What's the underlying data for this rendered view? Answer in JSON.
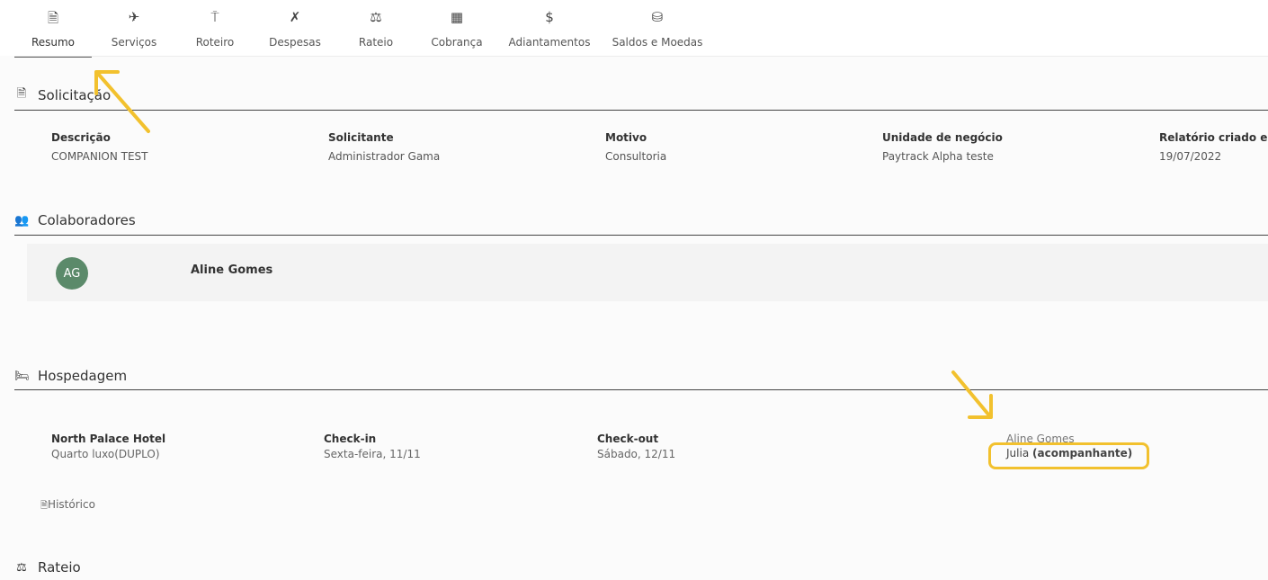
{
  "tabs": [
    {
      "label": "Resumo",
      "icon": "document-icon",
      "glyph": "🗎"
    },
    {
      "label": "Serviços",
      "icon": "airplane-icon",
      "glyph": "✈"
    },
    {
      "label": "Roteiro",
      "icon": "signpost-icon",
      "glyph": "⍑"
    },
    {
      "label": "Despesas",
      "icon": "utensils-icon",
      "glyph": "✗"
    },
    {
      "label": "Rateio",
      "icon": "scale-icon",
      "glyph": "⚖"
    },
    {
      "label": "Cobrança",
      "icon": "calculator-icon",
      "glyph": "▦"
    },
    {
      "label": "Adiantamentos",
      "icon": "dollar-icon",
      "glyph": "$"
    },
    {
      "label": "Saldos e Moedas",
      "icon": "coins-icon",
      "glyph": "⛁"
    }
  ],
  "active_tab": "Resumo",
  "solicitacao": {
    "title": "Solicitação",
    "icon_glyph": "🗎",
    "fields": [
      {
        "label": "Descrição",
        "value": "COMPANION TEST"
      },
      {
        "label": "Solicitante",
        "value": "Administrador Gama"
      },
      {
        "label": "Motivo",
        "value": "Consultoria"
      },
      {
        "label": "Unidade de negócio",
        "value": "Paytrack Alpha teste"
      },
      {
        "label": "Relatório criado em",
        "value": "19/07/2022"
      }
    ]
  },
  "colaboradores": {
    "title": "Colaboradores",
    "icon_glyph": "👥",
    "items": [
      {
        "initials": "AG",
        "name": "Aline Gomes"
      }
    ]
  },
  "hospedagem": {
    "title": "Hospedagem",
    "icon_glyph": "🛏",
    "hotel_name": "North Palace Hotel",
    "room": "Quarto luxo(DUPLO)",
    "checkin_label": "Check-in",
    "checkin_value": "Sexta-feira, 11/11",
    "checkout_label": "Check-out",
    "checkout_value": "Sábado, 12/11",
    "guest_1": "Aline Gomes",
    "guest_2_name": "Julia",
    "guest_2_role": "(acompanhante)",
    "historico": "Histórico"
  },
  "rateio": {
    "title": "Rateio",
    "icon_glyph": "⚖"
  },
  "colors": {
    "highlight": "#f2c12e",
    "avatar": "#5b8a6a"
  }
}
